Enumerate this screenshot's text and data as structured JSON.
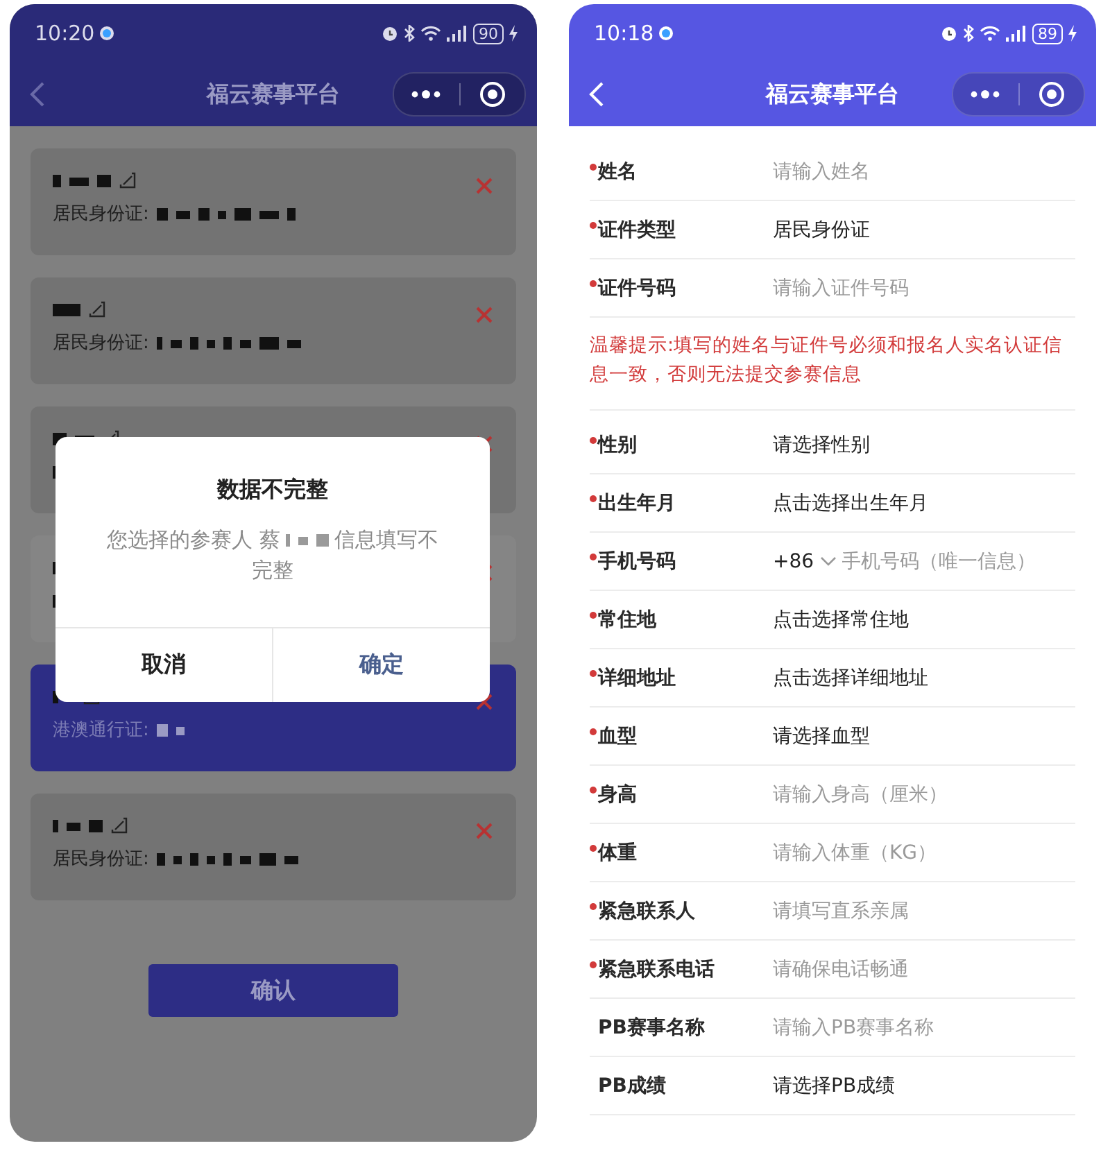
{
  "phones": [
    {
      "kind": "list",
      "status_bar": {
        "time": "10:20",
        "battery": "90"
      },
      "nav": {
        "title": "福云赛事平台"
      },
      "participants": [
        {
          "id_type": "居民身份证:",
          "selected": false
        },
        {
          "id_type": "居民身份证:",
          "selected": false
        },
        {
          "selected": false
        },
        {
          "selected": false
        },
        {
          "id_type": "港澳通行证:",
          "selected": true
        },
        {
          "id_type": "居民身份证:",
          "selected": false
        }
      ],
      "confirm_button": "确认",
      "dialog": {
        "title": "数据不完整",
        "message_lines": [
          {
            "before": "您选择的参赛人 蔡",
            "after": "信息填写不",
            "redacted": true
          },
          {
            "before": "完整",
            "redacted": false
          }
        ],
        "buttons": [
          {
            "label": "取消",
            "kind": "cancel"
          },
          {
            "label": "确定",
            "kind": "confirm"
          }
        ]
      }
    },
    {
      "kind": "form",
      "status_bar": {
        "time": "10:18",
        "battery": "89"
      },
      "nav": {
        "title": "福云赛事平台"
      },
      "rows": [
        {
          "kind": "input",
          "required": true,
          "label": "姓名",
          "placeholder": "请输入姓名"
        },
        {
          "kind": "select",
          "required": true,
          "label": "证件类型",
          "value": "居民身份证"
        },
        {
          "kind": "input",
          "required": true,
          "label": "证件号码",
          "placeholder": "请输入证件号码"
        },
        {
          "kind": "notice",
          "text": "温馨提示:填写的姓名与证件号必须和报名人实名认证信息一致，否则无法提交参赛信息"
        },
        {
          "kind": "select",
          "required": true,
          "label": "性别",
          "value": "请选择性别"
        },
        {
          "kind": "select",
          "required": true,
          "label": "出生年月",
          "value": "点击选择出生年月"
        },
        {
          "kind": "phone",
          "required": true,
          "label": "手机号码",
          "prefix": "+86",
          "placeholder": "手机号码（唯一信息）"
        },
        {
          "kind": "select",
          "required": true,
          "label": "常住地",
          "value": "点击选择常住地"
        },
        {
          "kind": "select",
          "required": true,
          "label": "详细地址",
          "value": "点击选择详细地址"
        },
        {
          "kind": "select",
          "required": true,
          "label": "血型",
          "value": "请选择血型"
        },
        {
          "kind": "input",
          "required": true,
          "label": "身高",
          "placeholder": "请输入身高（厘米）"
        },
        {
          "kind": "input",
          "required": true,
          "label": "体重",
          "placeholder": "请输入体重（KG）"
        },
        {
          "kind": "input",
          "required": true,
          "label": "紧急联系人",
          "placeholder": "请填写直系亲属"
        },
        {
          "kind": "input",
          "required": true,
          "label": "紧急联系电话",
          "placeholder": "请确保电话畅通"
        },
        {
          "kind": "input",
          "required": false,
          "label": "PB赛事名称",
          "placeholder": "请输入PB赛事名称"
        },
        {
          "kind": "select",
          "required": false,
          "label": "PB成绩",
          "value": "请选择PB成绩"
        }
      ]
    }
  ]
}
